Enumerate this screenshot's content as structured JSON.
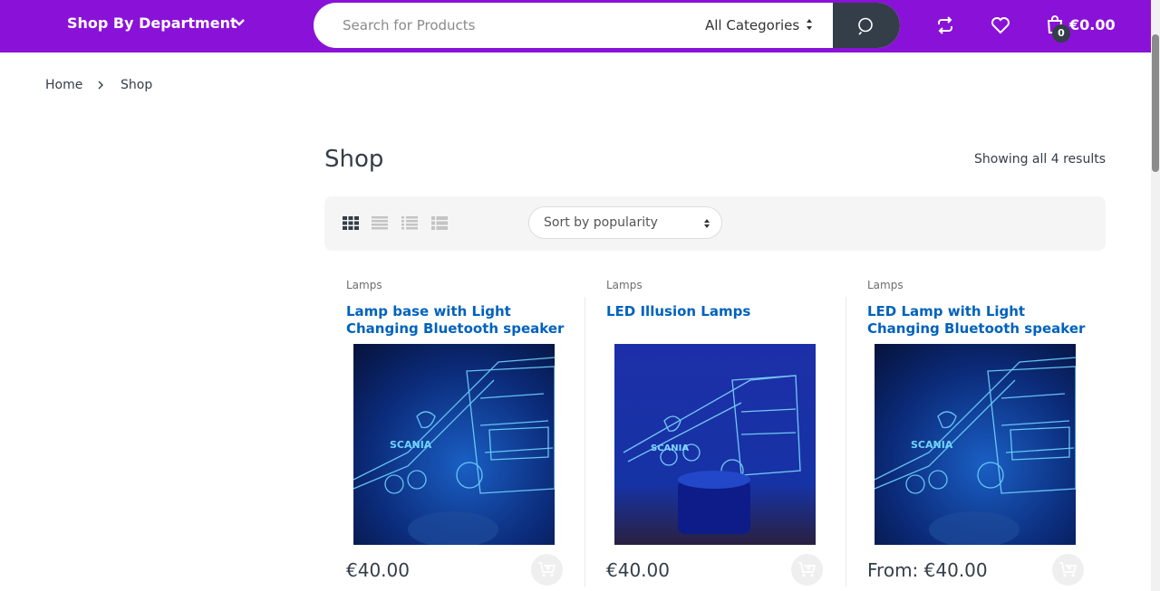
{
  "header": {
    "department_label": "Shop By Department",
    "search_placeholder": "Search for Products",
    "category_select": "All Categories",
    "cart_count": "0",
    "cart_total": "€0.00",
    "accent_color": "#8a12d8"
  },
  "breadcrumb": {
    "home": "Home",
    "current": "Shop"
  },
  "page": {
    "title": "Shop",
    "results_text": "Showing all 4 results"
  },
  "toolbar": {
    "sort_selected": "Sort by popularity",
    "view_modes": [
      "grid-view-icon",
      "grid-extended-view-icon",
      "list-view-icon",
      "list-small-view-icon"
    ]
  },
  "products": [
    {
      "category": "Lamps",
      "title": "Lamp base with Light Changing Bluetooth speaker",
      "price": "€40.00"
    },
    {
      "category": "Lamps",
      "title": "LED Illusion Lamps",
      "price": "€40.00"
    },
    {
      "category": "Lamps",
      "title": "LED Lamp with Light Changing Bluetooth speaker",
      "price": "From: €40.00"
    }
  ]
}
